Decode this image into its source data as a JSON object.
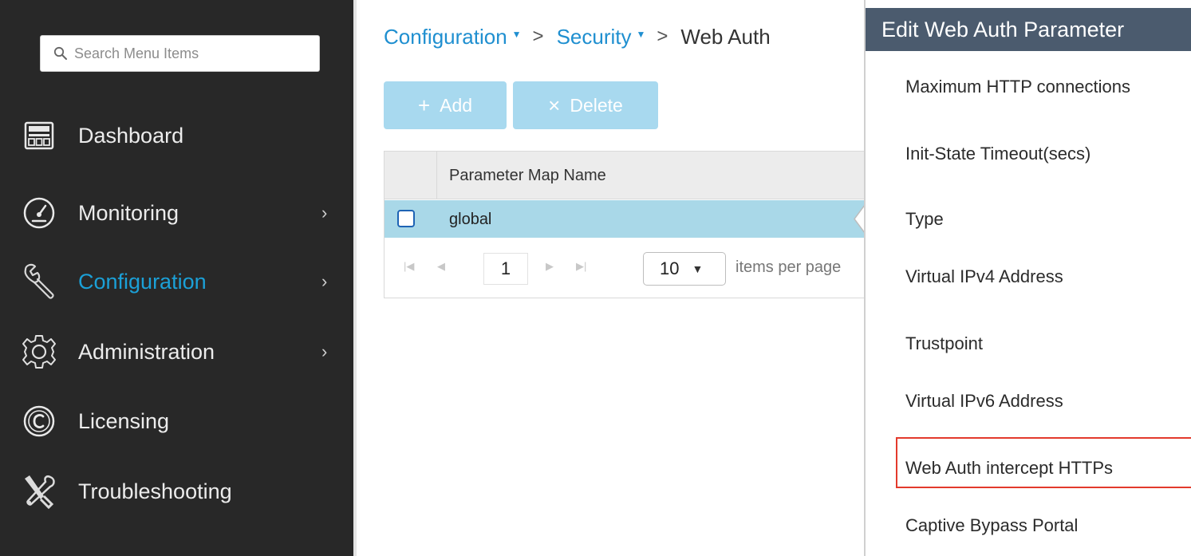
{
  "search": {
    "placeholder": "Search Menu Items"
  },
  "nav": {
    "dashboard": "Dashboard",
    "monitoring": "Monitoring",
    "configuration": "Configuration",
    "administration": "Administration",
    "licensing": "Licensing",
    "troubleshooting": "Troubleshooting",
    "chevron": "›"
  },
  "breadcrumb": {
    "configuration": "Configuration",
    "security": "Security",
    "current": "Web Auth",
    "separator": ">",
    "caret": "▼"
  },
  "toolbar": {
    "add_symbol": "+",
    "add_label": "Add",
    "delete_symbol": "×",
    "delete_label": "Delete"
  },
  "table": {
    "column_header": "Parameter Map Name",
    "rows": [
      {
        "name": "global"
      }
    ]
  },
  "pager": {
    "current_page": "1",
    "per_page_value": "10",
    "per_page_label": "items per page"
  },
  "panel": {
    "title": "Edit Web Auth Parameter",
    "fields": [
      "Maximum HTTP connections",
      "Init-State Timeout(secs)",
      "Type",
      "Virtual IPv4 Address",
      "Trustpoint",
      "Virtual IPv6 Address",
      "Web Auth intercept HTTPs",
      "Captive Bypass Portal"
    ]
  },
  "colors": {
    "sidebar_bg": "#282828",
    "accent": "#1ba0d7",
    "panel_header_bg": "#4b5b6e",
    "selected_row": "#a9d8e8",
    "highlight_border": "#e33a2c",
    "button_bg": "#a8d9ef"
  },
  "icons": {
    "search": "search-icon",
    "dashboard": "dashboard-icon",
    "monitoring": "gauge-icon",
    "configuration": "wrench-icon",
    "administration": "gear-icon",
    "licensing": "copyright-icon",
    "troubleshooting": "tools-icon"
  }
}
